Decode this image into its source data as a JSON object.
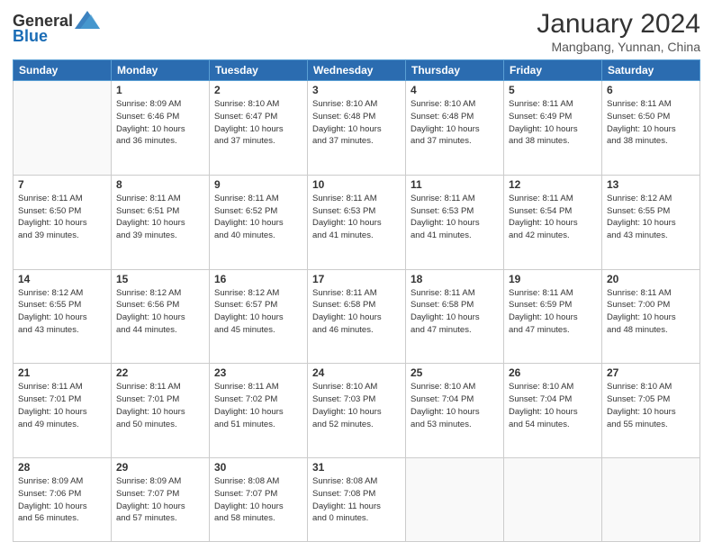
{
  "header": {
    "logo_text_general": "General",
    "logo_text_blue": "Blue",
    "month_title": "January 2024",
    "location": "Mangbang, Yunnan, China"
  },
  "days_of_week": [
    "Sunday",
    "Monday",
    "Tuesday",
    "Wednesday",
    "Thursday",
    "Friday",
    "Saturday"
  ],
  "weeks": [
    [
      {
        "day": "",
        "info": ""
      },
      {
        "day": "1",
        "info": "Sunrise: 8:09 AM\nSunset: 6:46 PM\nDaylight: 10 hours\nand 36 minutes."
      },
      {
        "day": "2",
        "info": "Sunrise: 8:10 AM\nSunset: 6:47 PM\nDaylight: 10 hours\nand 37 minutes."
      },
      {
        "day": "3",
        "info": "Sunrise: 8:10 AM\nSunset: 6:48 PM\nDaylight: 10 hours\nand 37 minutes."
      },
      {
        "day": "4",
        "info": "Sunrise: 8:10 AM\nSunset: 6:48 PM\nDaylight: 10 hours\nand 37 minutes."
      },
      {
        "day": "5",
        "info": "Sunrise: 8:11 AM\nSunset: 6:49 PM\nDaylight: 10 hours\nand 38 minutes."
      },
      {
        "day": "6",
        "info": "Sunrise: 8:11 AM\nSunset: 6:50 PM\nDaylight: 10 hours\nand 38 minutes."
      }
    ],
    [
      {
        "day": "7",
        "info": "Sunrise: 8:11 AM\nSunset: 6:50 PM\nDaylight: 10 hours\nand 39 minutes."
      },
      {
        "day": "8",
        "info": "Sunrise: 8:11 AM\nSunset: 6:51 PM\nDaylight: 10 hours\nand 39 minutes."
      },
      {
        "day": "9",
        "info": "Sunrise: 8:11 AM\nSunset: 6:52 PM\nDaylight: 10 hours\nand 40 minutes."
      },
      {
        "day": "10",
        "info": "Sunrise: 8:11 AM\nSunset: 6:53 PM\nDaylight: 10 hours\nand 41 minutes."
      },
      {
        "day": "11",
        "info": "Sunrise: 8:11 AM\nSunset: 6:53 PM\nDaylight: 10 hours\nand 41 minutes."
      },
      {
        "day": "12",
        "info": "Sunrise: 8:11 AM\nSunset: 6:54 PM\nDaylight: 10 hours\nand 42 minutes."
      },
      {
        "day": "13",
        "info": "Sunrise: 8:12 AM\nSunset: 6:55 PM\nDaylight: 10 hours\nand 43 minutes."
      }
    ],
    [
      {
        "day": "14",
        "info": "Sunrise: 8:12 AM\nSunset: 6:55 PM\nDaylight: 10 hours\nand 43 minutes."
      },
      {
        "day": "15",
        "info": "Sunrise: 8:12 AM\nSunset: 6:56 PM\nDaylight: 10 hours\nand 44 minutes."
      },
      {
        "day": "16",
        "info": "Sunrise: 8:12 AM\nSunset: 6:57 PM\nDaylight: 10 hours\nand 45 minutes."
      },
      {
        "day": "17",
        "info": "Sunrise: 8:11 AM\nSunset: 6:58 PM\nDaylight: 10 hours\nand 46 minutes."
      },
      {
        "day": "18",
        "info": "Sunrise: 8:11 AM\nSunset: 6:58 PM\nDaylight: 10 hours\nand 47 minutes."
      },
      {
        "day": "19",
        "info": "Sunrise: 8:11 AM\nSunset: 6:59 PM\nDaylight: 10 hours\nand 47 minutes."
      },
      {
        "day": "20",
        "info": "Sunrise: 8:11 AM\nSunset: 7:00 PM\nDaylight: 10 hours\nand 48 minutes."
      }
    ],
    [
      {
        "day": "21",
        "info": "Sunrise: 8:11 AM\nSunset: 7:01 PM\nDaylight: 10 hours\nand 49 minutes."
      },
      {
        "day": "22",
        "info": "Sunrise: 8:11 AM\nSunset: 7:01 PM\nDaylight: 10 hours\nand 50 minutes."
      },
      {
        "day": "23",
        "info": "Sunrise: 8:11 AM\nSunset: 7:02 PM\nDaylight: 10 hours\nand 51 minutes."
      },
      {
        "day": "24",
        "info": "Sunrise: 8:10 AM\nSunset: 7:03 PM\nDaylight: 10 hours\nand 52 minutes."
      },
      {
        "day": "25",
        "info": "Sunrise: 8:10 AM\nSunset: 7:04 PM\nDaylight: 10 hours\nand 53 minutes."
      },
      {
        "day": "26",
        "info": "Sunrise: 8:10 AM\nSunset: 7:04 PM\nDaylight: 10 hours\nand 54 minutes."
      },
      {
        "day": "27",
        "info": "Sunrise: 8:10 AM\nSunset: 7:05 PM\nDaylight: 10 hours\nand 55 minutes."
      }
    ],
    [
      {
        "day": "28",
        "info": "Sunrise: 8:09 AM\nSunset: 7:06 PM\nDaylight: 10 hours\nand 56 minutes."
      },
      {
        "day": "29",
        "info": "Sunrise: 8:09 AM\nSunset: 7:07 PM\nDaylight: 10 hours\nand 57 minutes."
      },
      {
        "day": "30",
        "info": "Sunrise: 8:08 AM\nSunset: 7:07 PM\nDaylight: 10 hours\nand 58 minutes."
      },
      {
        "day": "31",
        "info": "Sunrise: 8:08 AM\nSunset: 7:08 PM\nDaylight: 11 hours\nand 0 minutes."
      },
      {
        "day": "",
        "info": ""
      },
      {
        "day": "",
        "info": ""
      },
      {
        "day": "",
        "info": ""
      }
    ]
  ]
}
